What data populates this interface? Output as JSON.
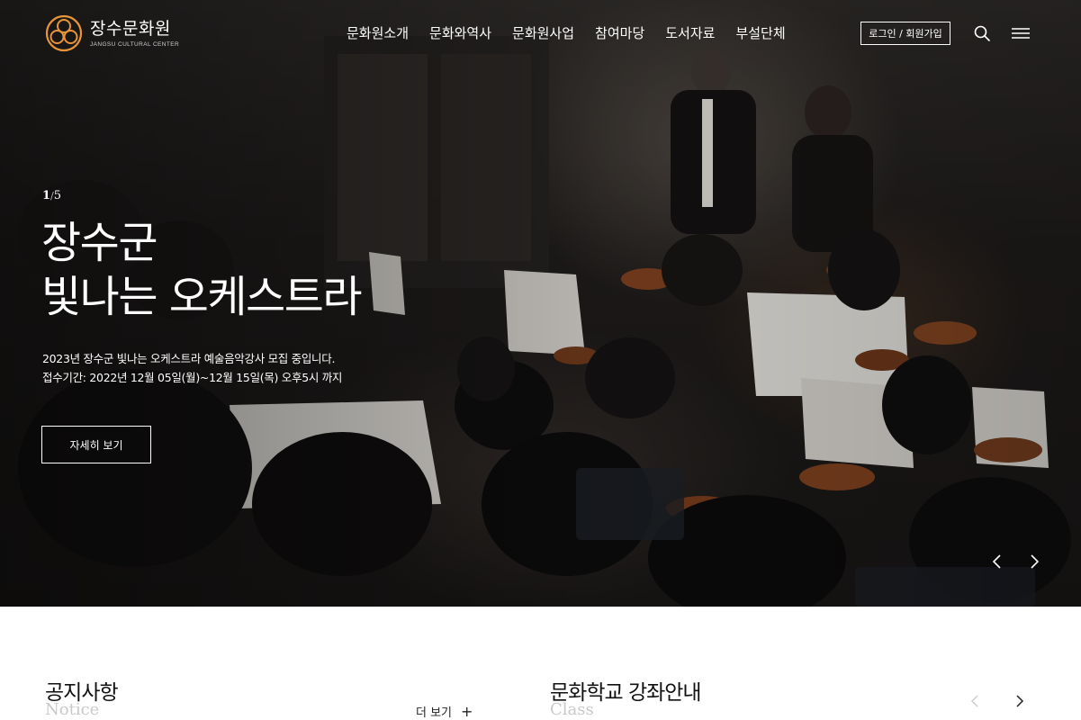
{
  "brand": {
    "name": "장수문화원",
    "subtitle": "JANGSU CULTURAL CENTER",
    "accent_color": "#e8953a"
  },
  "nav": {
    "items": [
      {
        "label": "문화원소개"
      },
      {
        "label": "문화와역사"
      },
      {
        "label": "문화원사업"
      },
      {
        "label": "참여마당"
      },
      {
        "label": "도서자료"
      },
      {
        "label": "부설단체"
      }
    ],
    "login_label": "로그인 / 회원가입",
    "search_icon": "search-icon",
    "menu_icon": "hamburger-menu-icon"
  },
  "hero": {
    "pager_current": "1",
    "pager_separator": "/",
    "pager_total": "5",
    "title_line1": "장수군",
    "title_line2": "빛나는 오케스트라",
    "desc_line1": "2023년 장수군 빛나는 오케스트라 예술음악강사 모집 중입니다.",
    "desc_line2": "접수기간: 2022년 12월 05일(월)~12월 15일(목) 오후5시 까지",
    "detail_button": "자세히 보기",
    "prev_icon": "chevron-left-icon",
    "next_icon": "chevron-right-icon"
  },
  "notice": {
    "title": "공지사항",
    "subtitle": "Notice",
    "more_label": "더 보기",
    "more_icon": "+"
  },
  "classes": {
    "title": "문화학교 강좌안내",
    "subtitle": "Class",
    "prev_icon": "chevron-left-icon",
    "next_icon": "chevron-right-icon"
  }
}
